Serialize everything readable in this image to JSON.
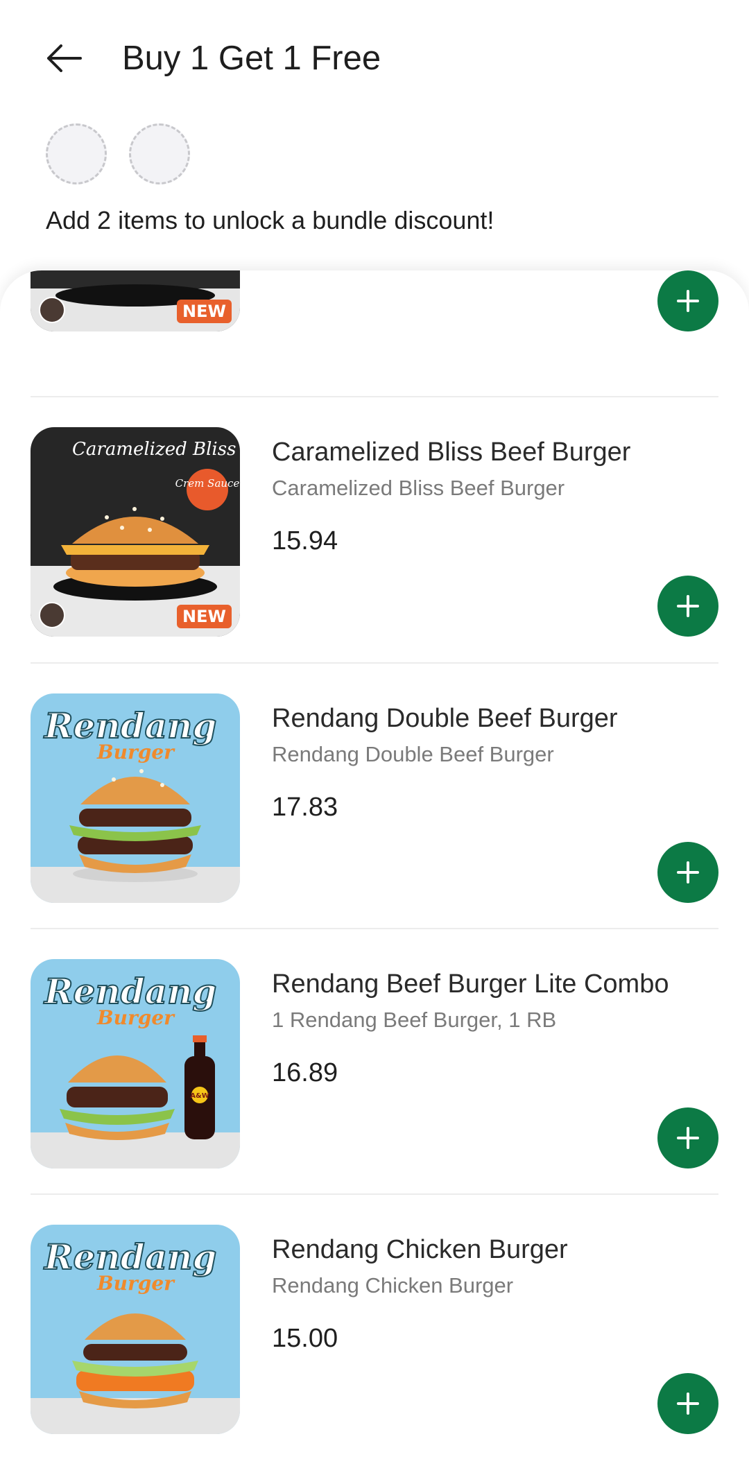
{
  "header": {
    "title": "Buy 1 Get 1 Free",
    "back_icon": "arrow-left-icon"
  },
  "bundle": {
    "message": "Add 2 items to unlock a bundle discount!",
    "slots_total": 2
  },
  "partial_item": {
    "badge": "NEW"
  },
  "items": [
    {
      "name": "Caramelized Bliss Beef Burger",
      "description": "Caramelized Bliss Beef Burger",
      "price": "15.94",
      "image_title": "Caramelized Bliss",
      "image_tag": "Crem Sauce",
      "badge": "NEW"
    },
    {
      "name": "Rendang Double Beef Burger",
      "description": "Rendang Double Beef Burger",
      "price": "17.83",
      "image_title": "Rendang",
      "image_subtitle": "Burger"
    },
    {
      "name": "Rendang Beef Burger Lite Combo",
      "description": "1 Rendang Beef Burger, 1 RB",
      "price": "16.89",
      "image_title": "Rendang",
      "image_subtitle": "Burger",
      "image_drink_label": "A&W"
    },
    {
      "name": "Rendang Chicken Burger",
      "description": "Rendang Chicken Burger",
      "price": "15.00",
      "image_title": "Rendang",
      "image_subtitle": "Burger"
    }
  ],
  "add_icon": "plus-icon",
  "colors": {
    "accent": "#0c7a45",
    "new_badge": "#e8602c"
  }
}
